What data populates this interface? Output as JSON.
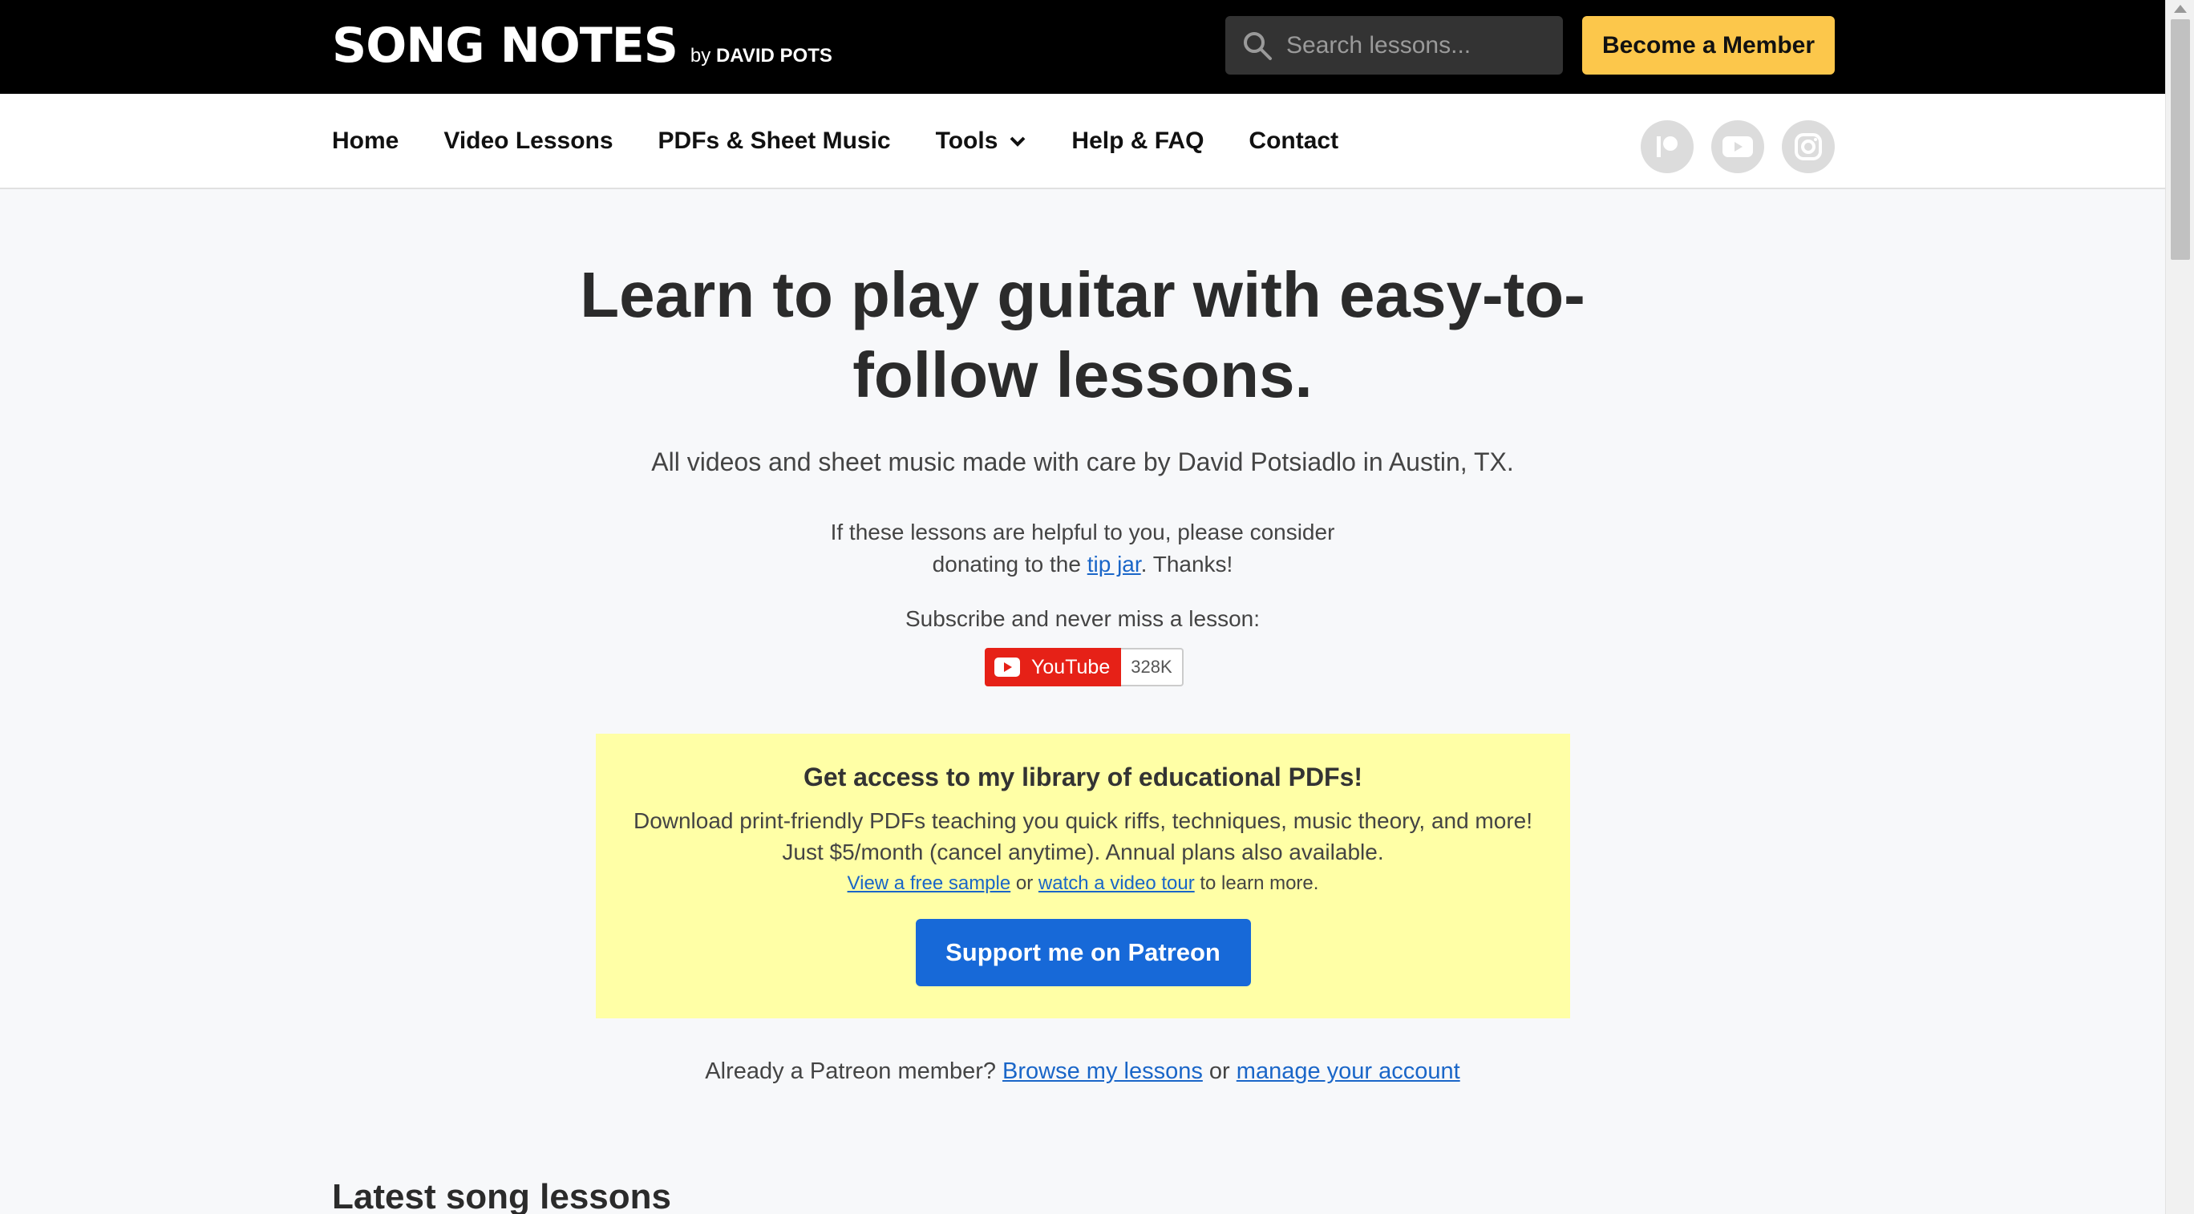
{
  "header": {
    "brand_main": "SONG NOTES",
    "brand_by": "by",
    "brand_name": "DAVID POTS",
    "search_placeholder": "Search lessons...",
    "member_button": "Become a Member"
  },
  "nav": {
    "items": [
      "Home",
      "Video Lessons",
      "PDFs & Sheet Music",
      "Tools",
      "Help & FAQ",
      "Contact"
    ],
    "socials": [
      "patreon-icon",
      "youtube-icon",
      "instagram-icon"
    ]
  },
  "hero": {
    "title": "Learn to play guitar with easy-to-follow lessons.",
    "subtitle": "All videos and sheet music made with care by David Potsiadlo in Austin, TX.",
    "tip_before": "If these lessons are helpful to you, please consider donating to the",
    "tip_link": "tip jar",
    "tip_after": ". Thanks!",
    "subscribe": "Subscribe and never miss a lesson:",
    "youtube_label": "YouTube",
    "youtube_count": "328K"
  },
  "promo": {
    "title": "Get access to my library of educational PDFs!",
    "body_line1": "Download print-friendly PDFs teaching you quick riffs, techniques, music theory, and more!",
    "body_line2": "Just $5/month (cancel anytime). Annual plans also available.",
    "sample_link": "View a free sample",
    "or": "or",
    "tour_link": "watch a video tour",
    "learn_more": "to learn more.",
    "button": "Support me on Patreon"
  },
  "member": {
    "prefix": "Already a Patreon member?",
    "browse_link": "Browse my lessons",
    "or": "or",
    "manage_link": "manage your account"
  },
  "latest_heading": "Latest song lessons",
  "colors": {
    "header_bg": "#000000",
    "member_button": "#fcc74b",
    "promo_bg": "#ffffa6",
    "patreon_button": "#1769d8",
    "link": "#1a66c8",
    "youtube_red": "#e62117"
  }
}
